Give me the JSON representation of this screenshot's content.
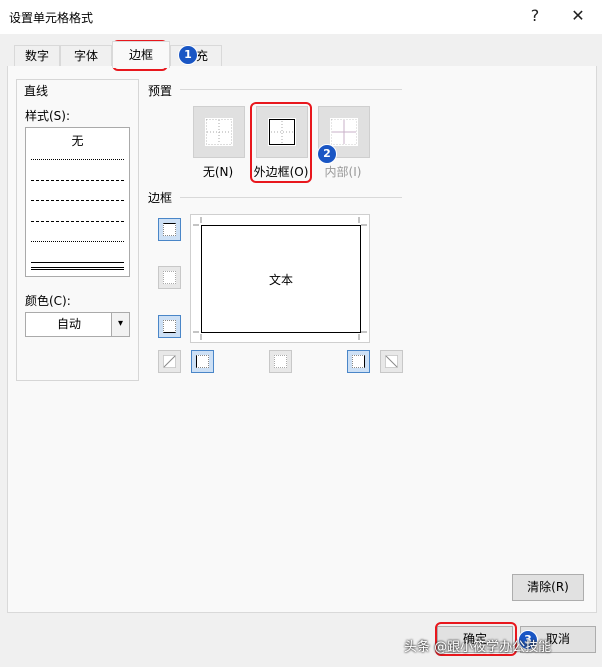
{
  "dialog": {
    "title": "设置单元格格式",
    "help_icon": "?",
    "close_icon": "✕"
  },
  "tabs": [
    {
      "label": "数字"
    },
    {
      "label": "字体"
    },
    {
      "label": "边框"
    },
    {
      "label": "填充"
    }
  ],
  "line": {
    "group_title": "直线",
    "style_label": "样式(S):",
    "style_none": "无",
    "color_label": "颜色(C):",
    "color_value": "自动"
  },
  "presets": {
    "title": "预置",
    "items": [
      {
        "label": "无(N)"
      },
      {
        "label": "外边框(O)"
      },
      {
        "label": "内部(I)"
      }
    ]
  },
  "border": {
    "title": "边框",
    "preview_text": "文本"
  },
  "buttons": {
    "clear": "清除(R)",
    "ok": "确定",
    "cancel": "取消"
  },
  "annotations": {
    "badge1": "1",
    "badge2": "2",
    "badge3": "3"
  },
  "watermark": "头条 @跟小筱学办公技能"
}
